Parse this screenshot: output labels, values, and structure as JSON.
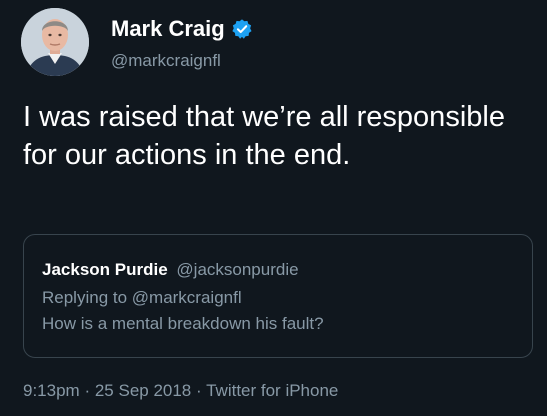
{
  "author": {
    "display_name": "Mark Craig",
    "handle": "@markcraignfl",
    "verified": true,
    "avatar_icon": "person-avatar-icon"
  },
  "tweet": {
    "text": "I was raised that we’re all responsible for our actions in the end."
  },
  "quoted_tweet": {
    "display_name": "Jackson Purdie",
    "handle": "@jacksonpurdie",
    "reply_context": "Replying to @markcraignfl",
    "text": "How is a mental breakdown his fault?"
  },
  "meta": {
    "time": "9:13pm",
    "separator": "·",
    "date": "25 Sep 2018",
    "source": "Twitter for iPhone"
  },
  "colors": {
    "background": "#10171e",
    "primary_text": "#ffffff",
    "secondary_text": "#8899a6",
    "border": "#38444d",
    "verified_badge": "#1da1f2"
  }
}
